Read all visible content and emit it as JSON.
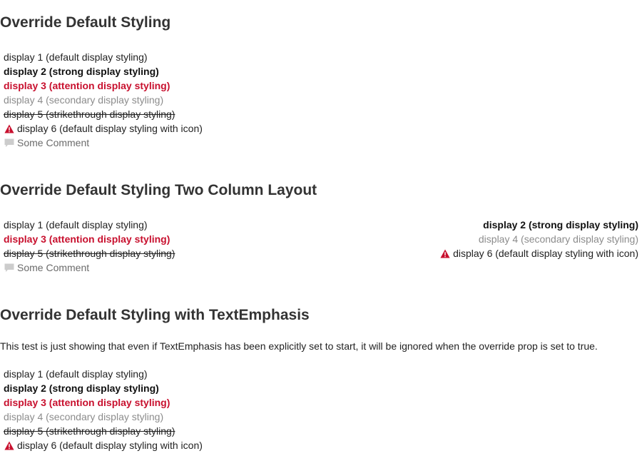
{
  "sections": [
    {
      "title": "Override Default Styling",
      "items": [
        "display 1 (default display styling)",
        "display 2 (strong display styling)",
        "display 3 (attention display styling)",
        "display 4 (secondary display styling)",
        "display 5 (strikethrough display styling)",
        "display 6 (default display styling with icon)",
        "Some Comment"
      ]
    },
    {
      "title": "Override Default Styling Two Column Layout",
      "left_items": [
        "display 1 (default display styling)",
        "display 3 (attention display styling)",
        "display 5 (strikethrough display styling)",
        "Some Comment"
      ],
      "right_items": [
        "display 2 (strong display styling)",
        "display 4 (secondary display styling)",
        "display 6 (default display styling with icon)"
      ]
    },
    {
      "title": "Override Default Styling with TextEmphasis",
      "description": "This test is just showing that even if TextEmphasis has been explicitly set to start, it will be ignored when the override prop is set to true.",
      "items": [
        "display 1 (default display styling)",
        "display 2 (strong display styling)",
        "display 3 (attention display styling)",
        "display 4 (secondary display styling)",
        "display 5 (strikethrough display styling)",
        "display 6 (default display styling with icon)"
      ]
    }
  ],
  "icons": {
    "warning": "warning-triangle-icon",
    "comment": "comment-icon"
  },
  "colors": {
    "attention": "#c8102e",
    "secondary": "#8c8c8c",
    "comment_icon": "#cccccc"
  }
}
